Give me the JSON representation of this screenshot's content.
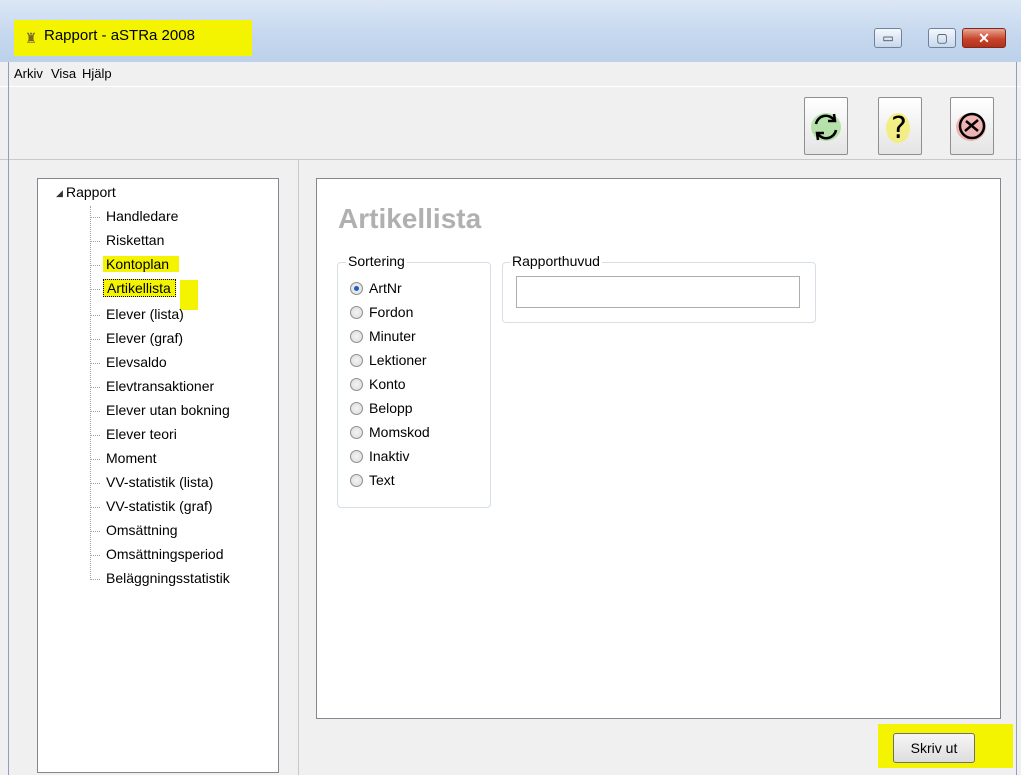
{
  "window": {
    "title": "Rapport - aSTRa 2008",
    "controls": {
      "minimize": "▭",
      "maximize": "▢",
      "close": "✕"
    }
  },
  "menu": [
    "Arkiv",
    "Visa",
    "Hjälp"
  ],
  "toolbar": {
    "buttons": [
      {
        "name": "refresh",
        "icon": "refresh-icon"
      },
      {
        "name": "help",
        "icon": "help-icon"
      },
      {
        "name": "exit",
        "icon": "exit-icon"
      }
    ]
  },
  "tree": {
    "root": "Rapport",
    "expander": "◢",
    "items": [
      "Handledare",
      "Riskettan",
      "Kontoplan",
      "Artikellista",
      "Elever (lista)",
      "Elever (graf)",
      "Elevsaldo",
      "Elevtransaktioner",
      "Elever utan bokning",
      "Elever teori",
      "Moment",
      "VV-statistik (lista)",
      "VV-statistik (graf)",
      "Omsättning",
      "Omsättningsperiod",
      "Beläggningsstatistik"
    ],
    "selected": "Artikellista"
  },
  "main": {
    "title": "Artikellista",
    "sorting": {
      "label": "Sortering",
      "options": [
        "ArtNr",
        "Fordon",
        "Minuter",
        "Lektioner",
        "Konto",
        "Belopp",
        "Momskod",
        "Inaktiv",
        "Text"
      ],
      "selected": "ArtNr"
    },
    "header": {
      "label": "Rapporthuvud",
      "value": ""
    },
    "print_button": "Skriv ut"
  },
  "colors": {
    "highlight": "#f4f400",
    "radio_checked": "#1b5fc0",
    "title_gray": "#b0b0b0"
  }
}
